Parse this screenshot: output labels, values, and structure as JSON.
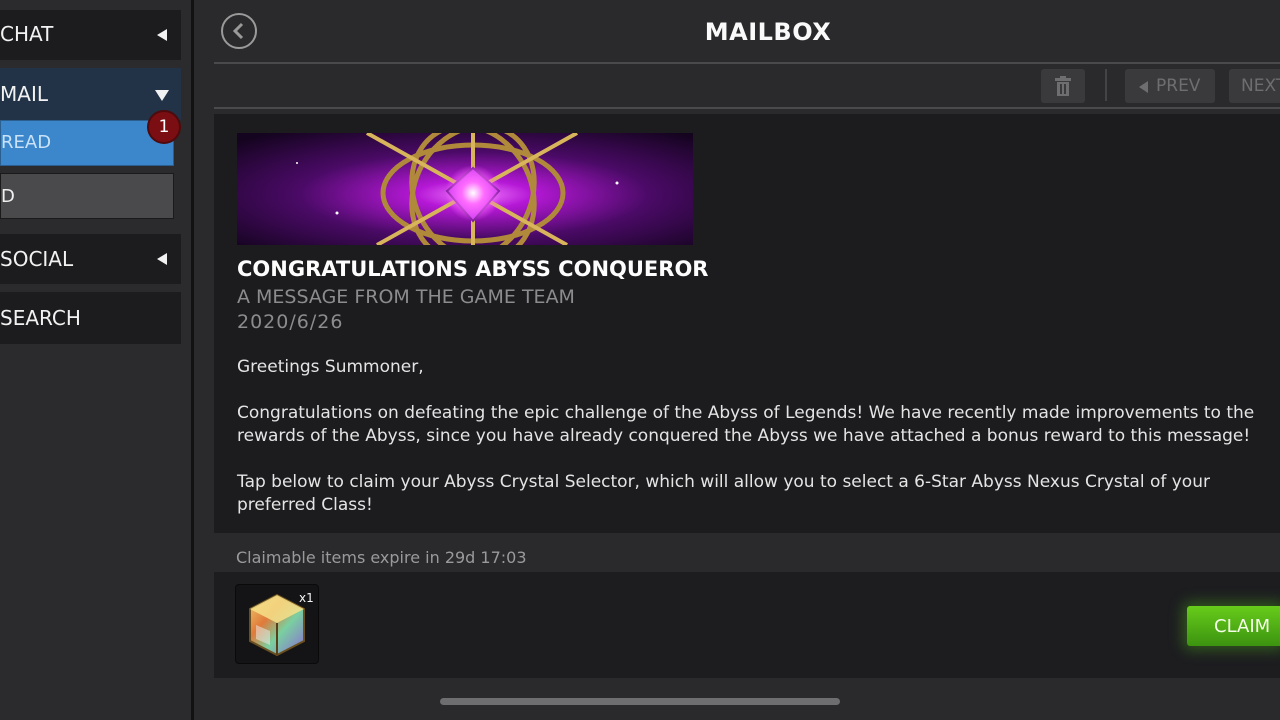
{
  "sidebar": {
    "chat_label": "CHAT",
    "mail_label": "MAIL",
    "unread_label": "READ",
    "unread_count": "1",
    "read_label": "D",
    "social_label": "SOCIAL",
    "search_label": "SEARCH"
  },
  "header": {
    "title": "MAILBOX"
  },
  "toolbar": {
    "prev_label": "PREV",
    "next_label": "NEXT"
  },
  "message": {
    "title": "CONGRATULATIONS ABYSS CONQUEROR",
    "sender": "A MESSAGE FROM THE GAME TEAM",
    "date": "2020/6/26",
    "greeting": "Greetings Summoner,",
    "para1_line1": "Congratulations on defeating the epic challenge of the Abyss of Legends! We have recently made improvements to the",
    "para1_line2": "rewards of the Abyss, since you have already conquered the Abyss we have attached a bonus reward to this message!",
    "para2_line1": "Tap below to claim your Abyss Crystal Selector, which will allow you to select a 6-Star Abyss Nexus Crystal of your",
    "para2_line2": "preferred Class!"
  },
  "reward": {
    "expiry_text": "Claimable items expire in 29d 17:03",
    "item_quantity": "x1",
    "item_icon": "crystal-selector-icon",
    "claim_label": "CLAIM"
  },
  "colors": {
    "background": "#2a2a2c",
    "panel": "#1c1c1f",
    "unread_tab": "#3c87cc",
    "badge": "#7a0e12",
    "claim_green": "#4fb014",
    "banner_magenta": "#d01ff0"
  }
}
